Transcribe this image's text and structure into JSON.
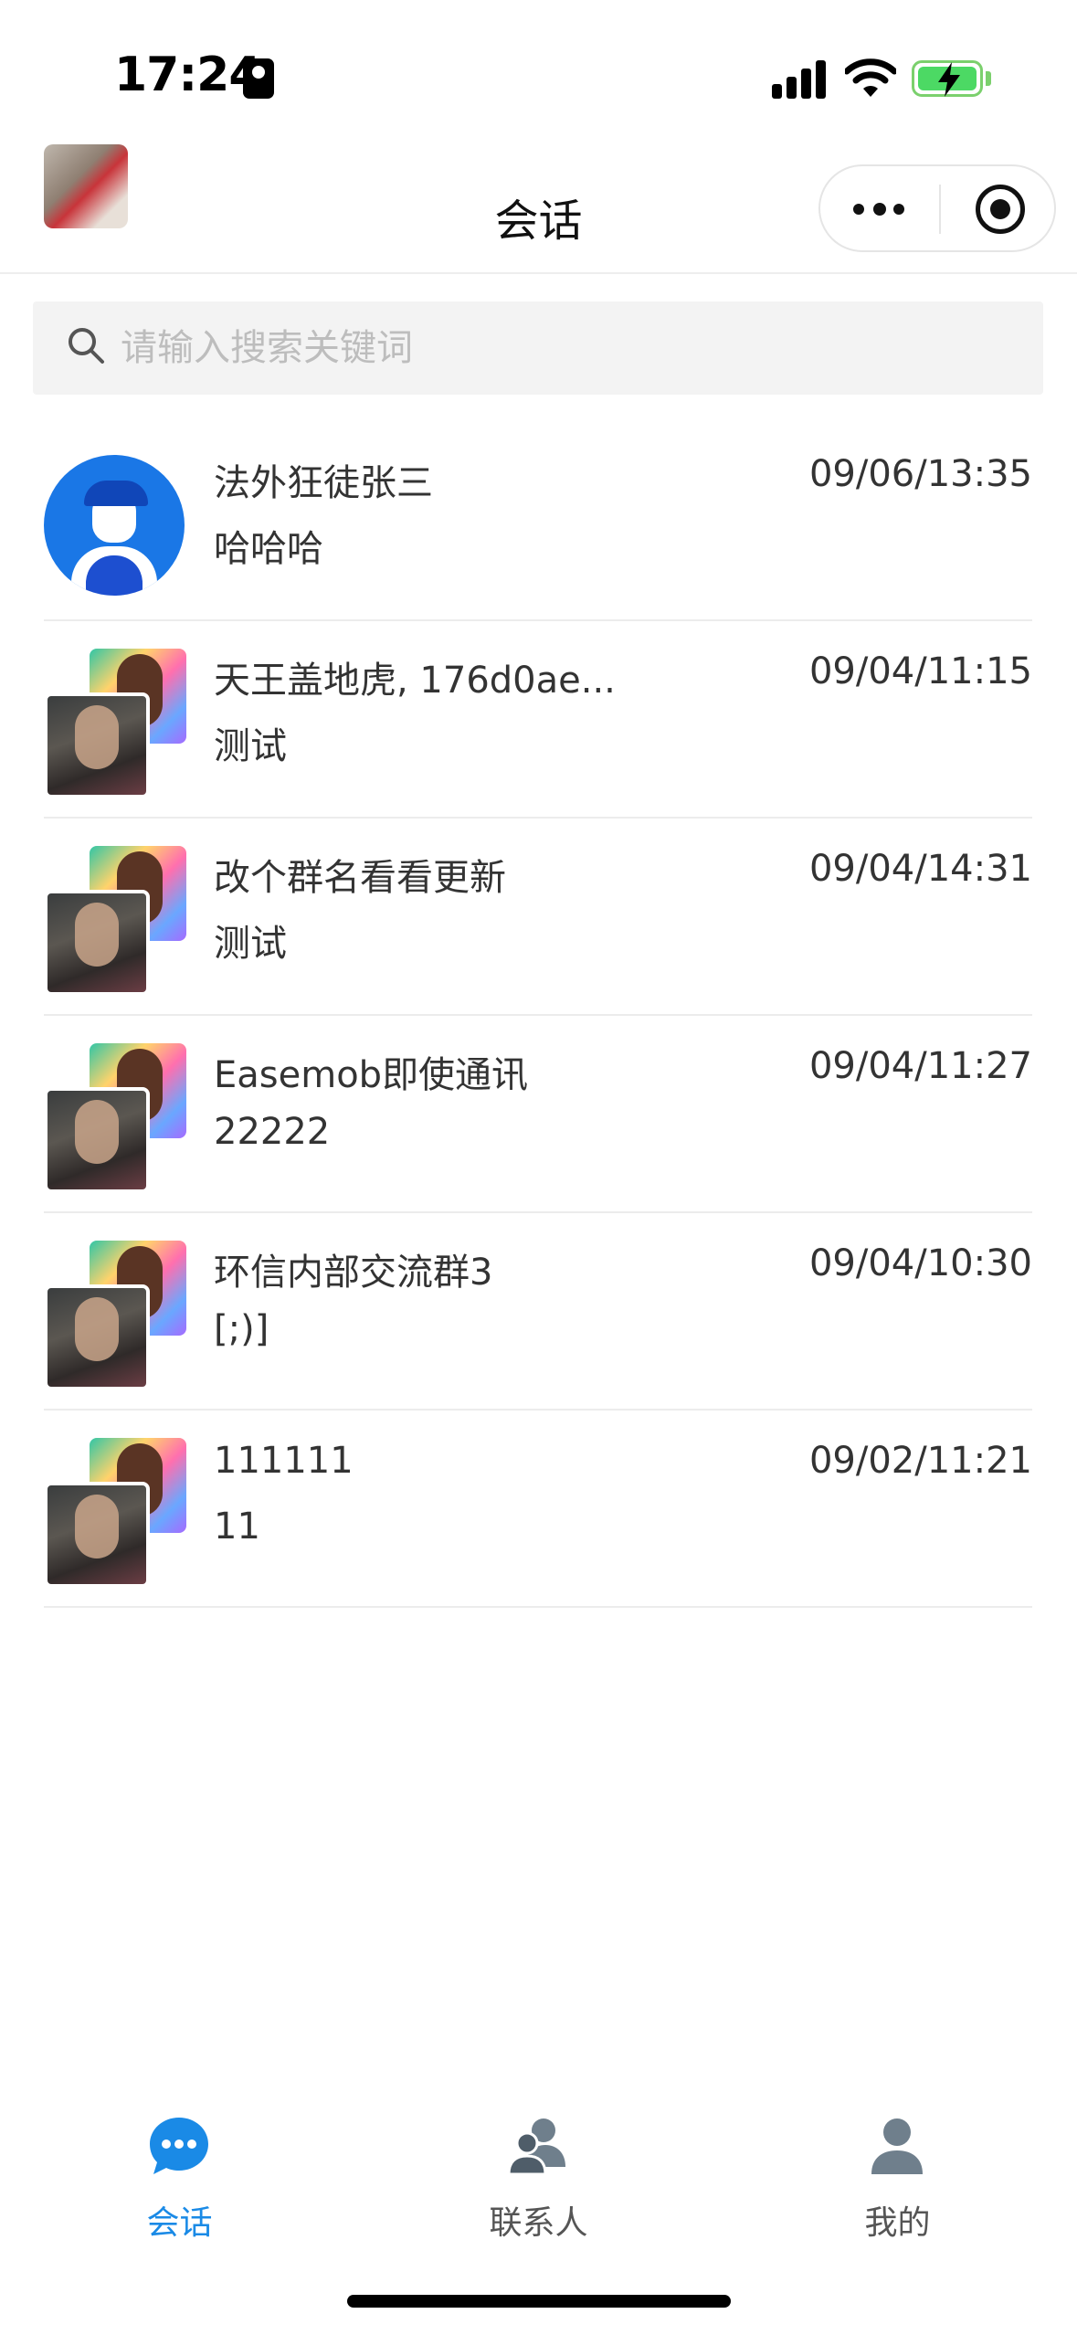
{
  "status_bar": {
    "time": "17:24"
  },
  "nav": {
    "title": "会话"
  },
  "search": {
    "placeholder": "请输入搜索关键词",
    "value": ""
  },
  "conversations": [
    {
      "name": "法外狂徒张三",
      "message": "哈哈哈",
      "time": "09/06/13:35",
      "avatar": "single-user"
    },
    {
      "name": "天王盖地虎, 176d0ae...",
      "message": "测试",
      "time": "09/04/11:15",
      "avatar": "group"
    },
    {
      "name": "改个群名看看更新",
      "message": "测试",
      "time": "09/04/14:31",
      "avatar": "group"
    },
    {
      "name": "Easemob即使通讯",
      "message": "22222",
      "time": "09/04/11:27",
      "avatar": "group"
    },
    {
      "name": "环信内部交流群3",
      "message": "[;)]",
      "time": "09/04/10:30",
      "avatar": "group"
    },
    {
      "name": "111111",
      "message": "11",
      "time": "09/02/11:21",
      "avatar": "group"
    }
  ],
  "tabbar": {
    "items": [
      {
        "label": "会话",
        "icon": "chat-bubble-icon",
        "active": true
      },
      {
        "label": "联系人",
        "icon": "contacts-icon",
        "active": false
      },
      {
        "label": "我的",
        "icon": "person-icon",
        "active": false
      }
    ],
    "active_color": "#1a8ae6",
    "inactive_color": "#555555"
  }
}
